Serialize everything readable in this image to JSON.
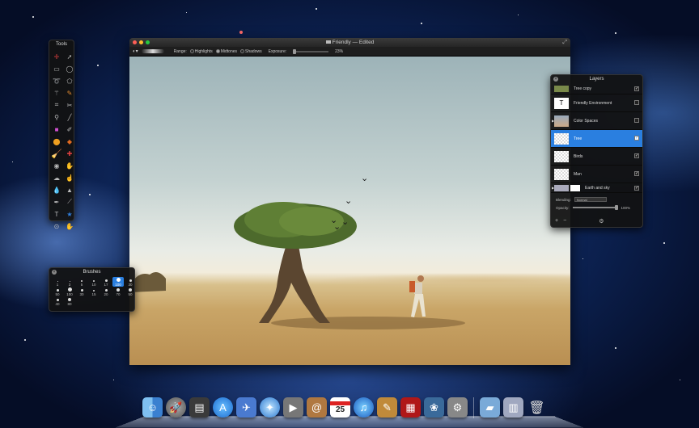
{
  "window": {
    "title": "Friendly — Edited",
    "traffic_colors": [
      "#ff5f56",
      "#ffbd2e",
      "#27c93f"
    ]
  },
  "options_bar": {
    "range_label": "Range:",
    "highlights_label": "Highlights",
    "midtones_label": "Midtones",
    "shadows_label": "Shadows",
    "exposure_label": "Exposure:",
    "exposure_value": "23%",
    "selected_range": "Midtones"
  },
  "tools_panel": {
    "title": "Tools",
    "icons": [
      "move-icon",
      "selection-arrow-icon",
      "rect-marquee-icon",
      "ellipse-marquee-icon",
      "lasso-icon",
      "polygon-lasso-icon",
      "magic-wand-icon",
      "quick-select-icon",
      "crop-icon",
      "slice-icon",
      "eyedropper-icon",
      "ruler-icon",
      "eraser-icon",
      "brush-icon",
      "gradient-icon",
      "paint-bucket-icon",
      "clone-stamp-icon",
      "healing-icon",
      "dodge-icon",
      "burn-icon",
      "sponge-icon",
      "smudge-icon",
      "blur-icon",
      "sharpen-icon",
      "pen-icon",
      "line-icon",
      "text-icon",
      "shape-icon",
      "zoom-icon",
      "hand-icon"
    ]
  },
  "brushes_panel": {
    "title": "Brushes",
    "sizes": [
      "1",
      "3",
      "5",
      "10",
      "17",
      "100",
      "30",
      "50",
      "100",
      "30",
      "15",
      "20",
      "70",
      "50",
      "40",
      "80"
    ],
    "selected": "100"
  },
  "layers_panel": {
    "title": "Layers",
    "layers": [
      {
        "name": "Tree copy",
        "visible": true
      },
      {
        "name": "Friendly Environment",
        "visible": false
      },
      {
        "name": "Color Spaces",
        "visible": false
      },
      {
        "name": "Tree",
        "visible": true,
        "selected": true
      },
      {
        "name": "Birds",
        "visible": true
      },
      {
        "name": "Man",
        "visible": true
      },
      {
        "name": "Earth and sky",
        "visible": true
      }
    ],
    "blending_label": "Blending:",
    "blending_value": "Normal",
    "opacity_label": "Opacity:",
    "opacity_value": "100%"
  },
  "dock": {
    "calendar_date": "25",
    "apps": [
      "finder-icon",
      "launchpad-icon",
      "photo-browser-icon",
      "app-store-icon",
      "preview-icon",
      "safari-icon",
      "facetime-icon",
      "address-book-icon",
      "calendar-icon",
      "itunes-icon",
      "pixelmator-icon",
      "photo-booth-icon",
      "iphoto-icon",
      "system-preferences-icon",
      "applications-folder-icon",
      "documents-stack-icon",
      "trash-icon"
    ]
  }
}
